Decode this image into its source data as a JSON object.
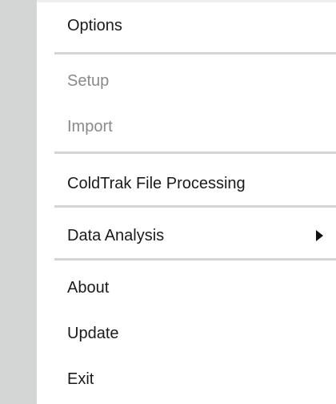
{
  "menu": {
    "items": [
      {
        "label": "Options",
        "enabled": true
      },
      {
        "label": "Setup",
        "enabled": false
      },
      {
        "label": "Import",
        "enabled": false
      },
      {
        "label": "ColdTrak File Processing",
        "enabled": true
      },
      {
        "label": "Data Analysis",
        "enabled": true,
        "submenu_icon": "submenu-arrow-icon"
      },
      {
        "label": "About",
        "enabled": true
      },
      {
        "label": "Update",
        "enabled": true
      },
      {
        "label": "Exit",
        "enabled": true
      }
    ]
  },
  "colors": {
    "gutter": "#d4d6d5",
    "separator": "#d4d6d5",
    "text": "#1a1a1a",
    "disabled_text": "#8a8a8a"
  }
}
